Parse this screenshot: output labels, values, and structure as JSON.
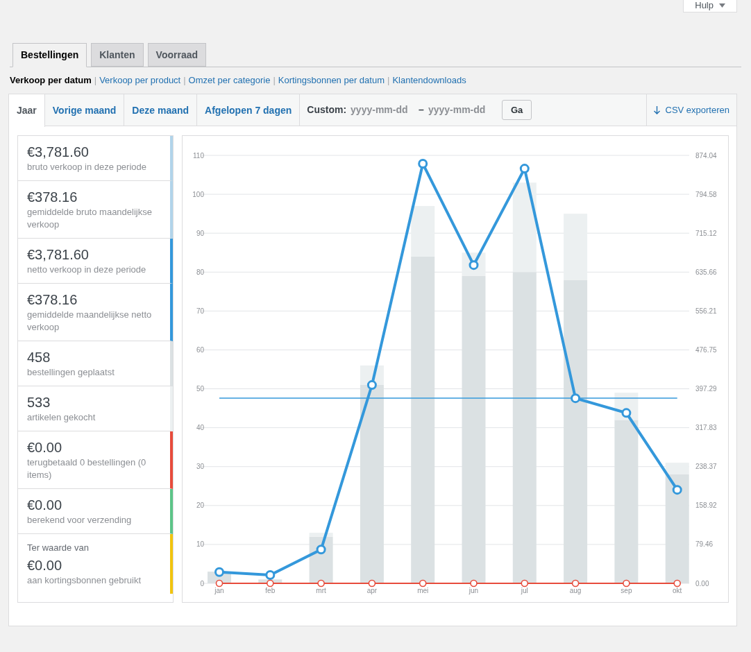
{
  "help_button": {
    "label": "Hulp"
  },
  "tabs": [
    {
      "label": "Bestellingen",
      "selected": true
    },
    {
      "label": "Klanten",
      "selected": false
    },
    {
      "label": "Voorraad",
      "selected": false
    }
  ],
  "report_links": [
    {
      "label": "Verkoop per datum",
      "selected": true
    },
    {
      "separator": "|",
      "label": "Verkoop per product",
      "selected": false
    },
    {
      "separator": "|",
      "label": "Omzet per categorie",
      "selected": false
    },
    {
      "separator": "|",
      "label": "Kortingsbonnen per datum",
      "selected": false
    },
    {
      "separator": "|",
      "label": "Klantendownloads",
      "selected": false
    }
  ],
  "range_tabs": [
    {
      "label": "Jaar",
      "selected": true
    },
    {
      "label": "Vorige maand",
      "selected": false
    },
    {
      "label": "Deze maand",
      "selected": false
    },
    {
      "label": "Afgelopen 7 dagen",
      "selected": false
    }
  ],
  "custom_range": {
    "label": "Custom:",
    "start_placeholder": "yyyy-mm-dd",
    "separator": "–",
    "end_placeholder": "yyyy-mm-dd",
    "button": "Ga"
  },
  "export_link": {
    "label": "CSV exporteren"
  },
  "legend": [
    {
      "value": "€3,781.60",
      "label": "bruto verkoop in deze periode",
      "color": "#b1d4ea"
    },
    {
      "value": "€378.16",
      "label": "gemiddelde bruto maandelijkse verkoop",
      "color": "#b1d4ea"
    },
    {
      "value": "€3,781.60",
      "label": "netto verkoop in deze periode",
      "color": "#3498db"
    },
    {
      "value": "€378.16",
      "label": "gemiddelde maandelijkse netto verkoop",
      "color": "#3498db"
    },
    {
      "value": "458",
      "label": "bestellingen geplaatst",
      "color": "#dbe1e3"
    },
    {
      "value": "533",
      "label": "artikelen gekocht",
      "color": "#ecf0f1"
    },
    {
      "value": "€0.00",
      "label": "terugbetaald 0 bestellingen (0 items)",
      "color": "#e74c3c"
    },
    {
      "value": "€0.00",
      "label": "berekend voor verzending",
      "color": "#5cc488"
    },
    {
      "prefix": "Ter waarde van",
      "value": "€0.00",
      "label": "aan kortingsbonnen gebruikt",
      "color": "#f1c40f"
    }
  ],
  "chart_data": {
    "type": "bar",
    "categories": [
      "jan",
      "feb",
      "mrt",
      "apr",
      "mei",
      "jun",
      "jul",
      "aug",
      "sep",
      "okt"
    ],
    "ylim": [
      0,
      110
    ],
    "yticks": [
      0,
      10,
      20,
      30,
      40,
      50,
      60,
      70,
      80,
      90,
      100,
      110
    ],
    "y2lim": [
      0,
      874.04
    ],
    "y2ticks": [
      {
        "value": 0,
        "label": "0.00"
      },
      {
        "value": 79.46,
        "label": "79.46"
      },
      {
        "value": 158.92,
        "label": "158.92"
      },
      {
        "value": 238.37,
        "label": "238.37"
      },
      {
        "value": 317.83,
        "label": "317.83"
      },
      {
        "value": 397.29,
        "label": "397.29"
      },
      {
        "value": 476.75,
        "label": "476.75"
      },
      {
        "value": 556.21,
        "label": "556.21"
      },
      {
        "value": 635.66,
        "label": "635.66"
      },
      {
        "value": 715.12,
        "label": "715.12"
      },
      {
        "value": 794.58,
        "label": "794.58"
      },
      {
        "value": 874.04,
        "label": "874.04"
      }
    ],
    "stacked": true,
    "series": [
      {
        "color": "#dbe1e3",
        "values": [
          3,
          1,
          12,
          51,
          84,
          79,
          80,
          78,
          42,
          28
        ]
      },
      {
        "color": "#ecf0f1",
        "values": [
          0,
          0,
          1,
          5,
          13,
          6,
          23,
          17,
          7,
          3
        ]
      },
      {
        "type": "line",
        "axis": "y2",
        "marker": "circle",
        "color": "#3498db",
        "values": [
          23,
          17,
          69,
          405,
          857,
          650,
          847,
          378,
          348,
          191
        ]
      },
      {
        "type": "line",
        "axis": "y2",
        "marker": "circle",
        "color": "#e74c3c",
        "values": [
          0,
          0,
          0,
          0,
          0,
          0,
          0,
          0,
          0,
          0
        ]
      }
    ],
    "ref_lines": [
      {
        "axis": "y2",
        "value": 378.16,
        "color": "#3498db"
      }
    ]
  }
}
